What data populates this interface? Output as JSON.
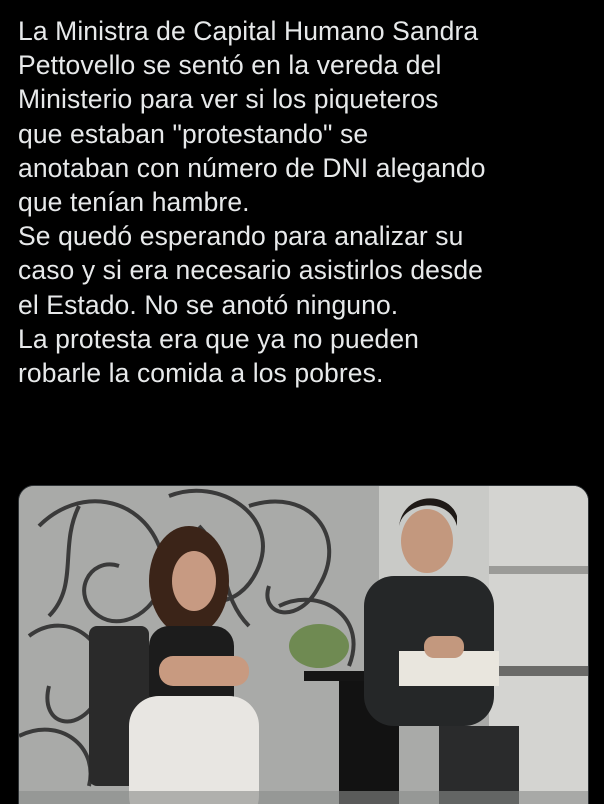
{
  "tweet": {
    "text_lines": [
      "La Ministra de Capital Humano Sandra",
      "Pettovello se sentó en la vereda del",
      "Ministerio para ver si los piqueteros",
      "que estaban \"protestando\" se",
      "anotaban con número de DNI alegando",
      "que tenían hambre.",
      "Se quedó esperando para analizar su",
      "caso y si era necesario asistirlos desde",
      "el Estado. No se anotó ninguno.",
      "La protesta era que ya no pueden",
      "robarle la comida a los pobres."
    ]
  },
  "colors": {
    "background": "#000000",
    "text": "#e7e9ea"
  }
}
